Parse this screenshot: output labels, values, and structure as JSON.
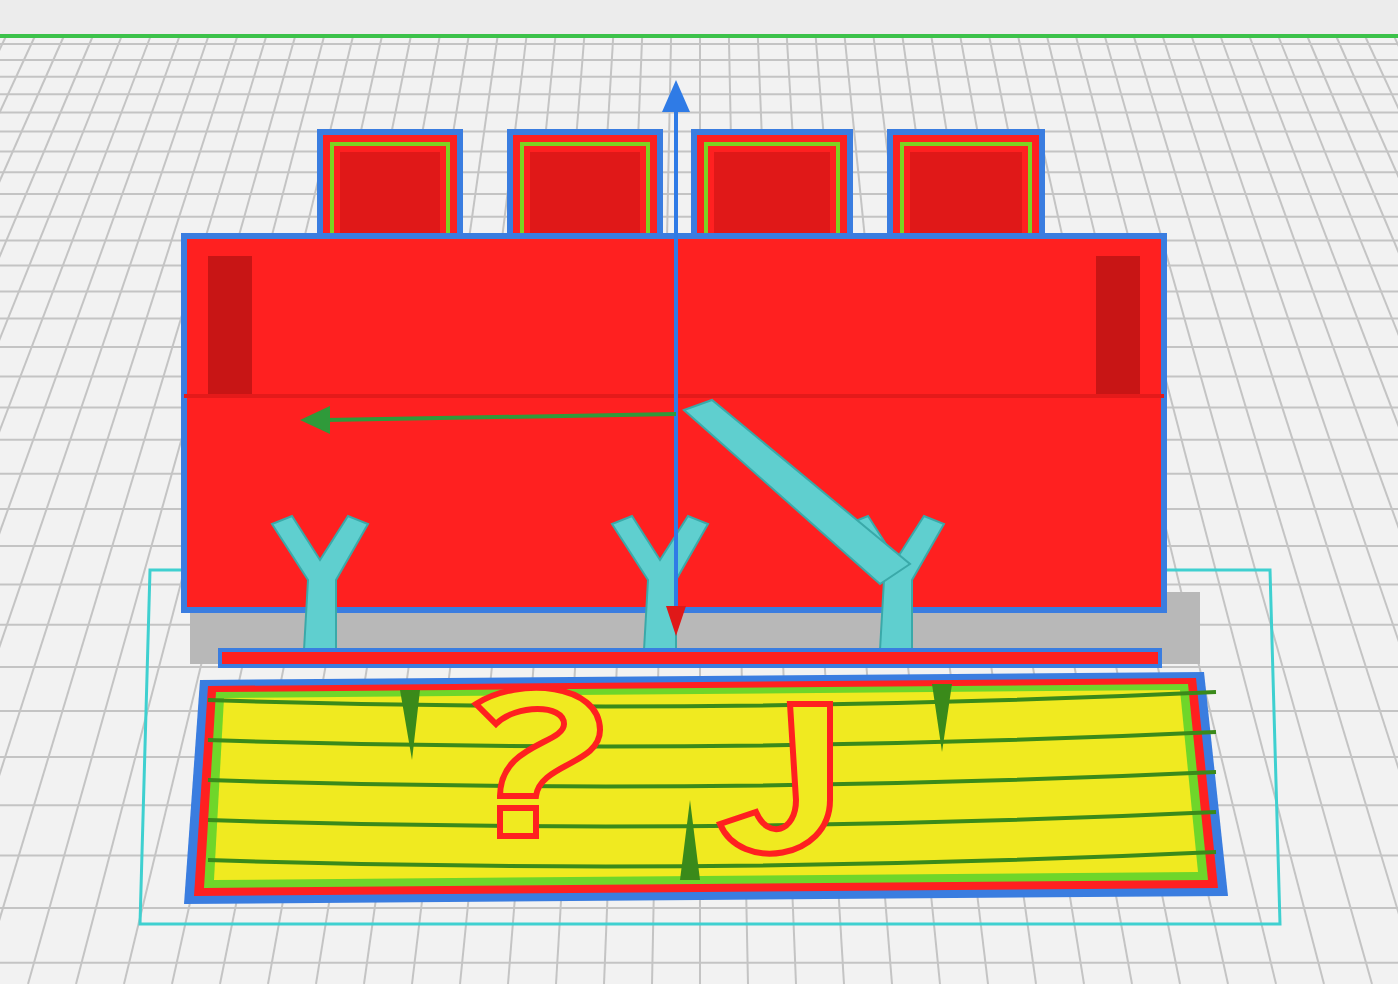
{
  "viewport": {
    "kind": "layer-view"
  }
}
